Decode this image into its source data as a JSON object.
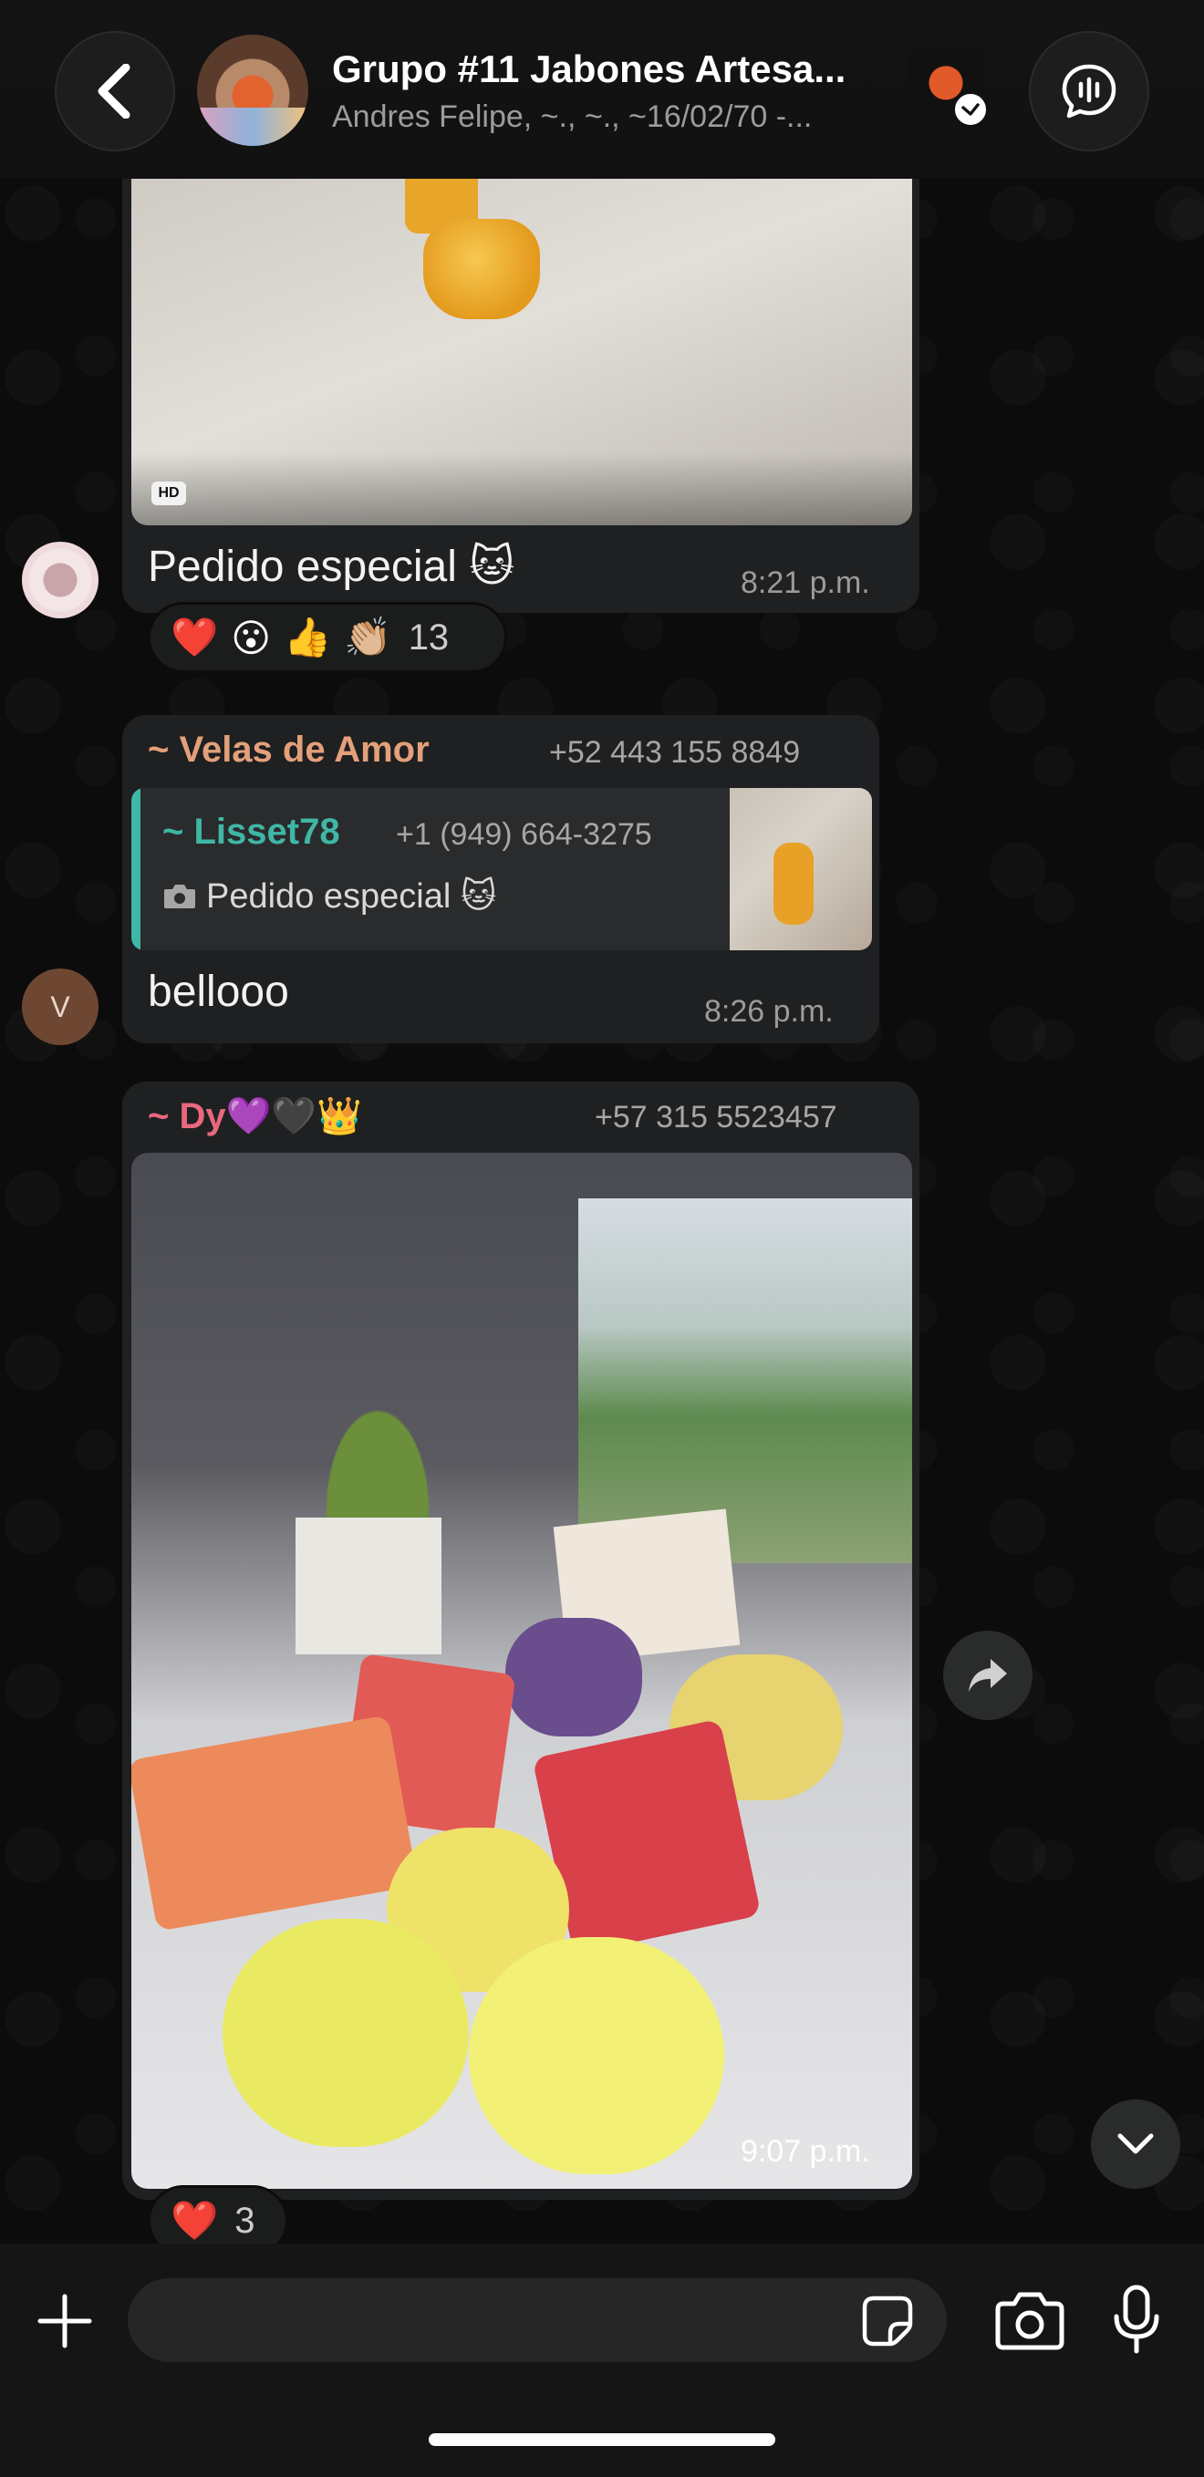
{
  "header": {
    "title": "Grupo #11 Jabones Artesa...",
    "subtitle": "Andres Felipe, ~., ~., ~16/02/70 -...",
    "back_icon": "chevron-left-icon",
    "call_icon": "voice-call-icon"
  },
  "messages": {
    "msg1": {
      "hd_label": "HD",
      "text": "Pedido especial 🐱",
      "time": "8:21 p.m.",
      "reactions": [
        "❤️",
        "😮",
        "👍",
        "👏🏼"
      ],
      "reaction_count": "13"
    },
    "msg2": {
      "sender": "~ Velas de Amor",
      "phone": "+52 443 155 8849",
      "avatar_initial": "V",
      "quote_sender": "~ Lisset78",
      "quote_phone": "+1 (949) 664-3275",
      "quote_text": "Pedido especial 🐱",
      "text": "bellooo",
      "time": "8:26 p.m."
    },
    "msg3": {
      "sender": "~ Dy💜🖤👑",
      "phone": "+57 315 5523457",
      "time": "9:07 p.m.",
      "reactions": [
        "❤️"
      ],
      "reaction_count": "3"
    }
  },
  "input": {
    "placeholder": "",
    "value": ""
  },
  "colors": {
    "bubble": "#1f2021",
    "accent_teal": "#3fb7a6",
    "sender_orange": "#e3a07a",
    "sender_pink": "#e9687e"
  }
}
